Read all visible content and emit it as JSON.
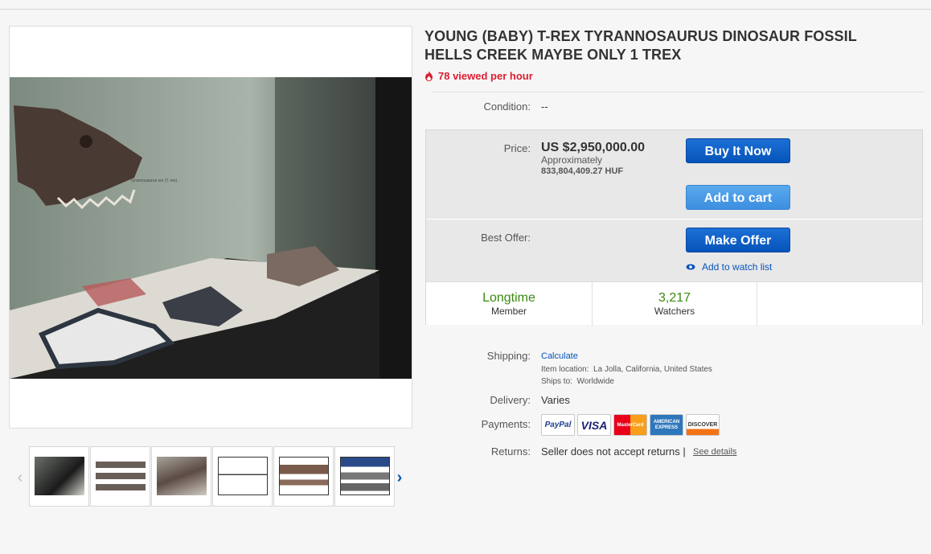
{
  "title": "YOUNG (BABY) T-REX TYRANNOSAURUS DINOSAUR FOSSIL HELLS CREEK MAYBE ONLY 1 TREX",
  "viewed": "78 viewed per hour",
  "condition": {
    "label": "Condition:",
    "value": "--"
  },
  "price": {
    "label": "Price:",
    "value": "US $2,950,000.00",
    "approx_label": "Approximately",
    "converted": "833,804,409.27 HUF"
  },
  "buttons": {
    "buy_now": "Buy It Now",
    "add_to_cart": "Add to cart",
    "make_offer": "Make Offer",
    "watch": "Add to watch list"
  },
  "best_offer_label": "Best Offer:",
  "stats": {
    "member": "Longtime",
    "member_sub": "Member",
    "watchers": "3,217",
    "watchers_sub": "Watchers"
  },
  "shipping": {
    "label": "Shipping:",
    "calculate": "Calculate",
    "location_label": "Item location:",
    "location": "La Jolla, California, United States",
    "ships_label": "Ships to:",
    "ships_to": "Worldwide"
  },
  "delivery": {
    "label": "Delivery:",
    "value": "Varies"
  },
  "payments": {
    "label": "Payments:",
    "methods": [
      "PayPal",
      "VISA",
      "MasterCard",
      "AMERICAN EXPRESS",
      "DISCOVER"
    ]
  },
  "returns": {
    "label": "Returns:",
    "value": "Seller does not accept returns |",
    "details": "See details"
  },
  "photo_label": "Tyrannosaurus rex (T. rex)",
  "colors": {
    "link": "#0654ba",
    "viewed": "#dd1e31",
    "green": "#3b8a0e"
  }
}
